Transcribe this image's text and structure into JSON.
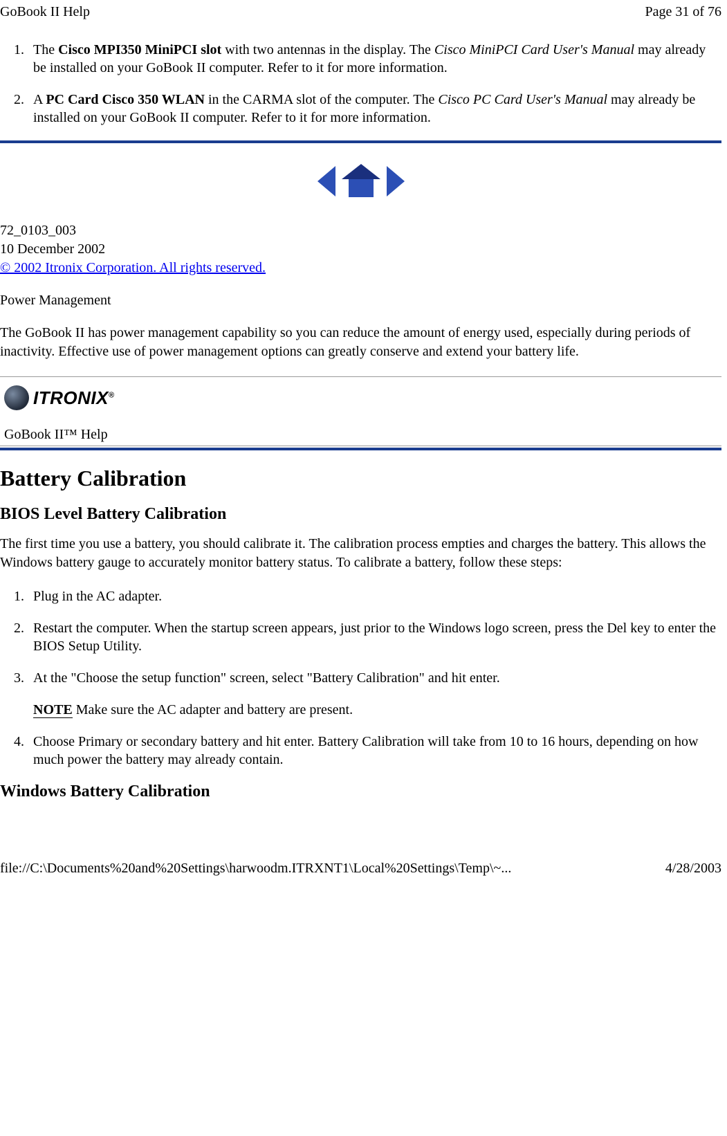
{
  "header": {
    "left": "GoBook II Help",
    "right": "Page 31 of 76"
  },
  "topList": {
    "item1": {
      "preText": "The ",
      "bold1": "Cisco MPI350 MiniPCI slot",
      "midText": " with two antennas in the display.  The ",
      "italic": "Cisco MiniPCI Card User's Manual",
      "tail": " may already be installed on your GoBook II computer.  Refer to it for more information."
    },
    "item2": {
      "preText": "A ",
      "bold1": "PC Card Cisco 350 WLAN",
      "midText": " in the CARMA slot of the computer.  The ",
      "italic": "Cisco PC Card User's Manual",
      "tail": " may already be installed on your GoBook II computer. Refer to it for more information."
    }
  },
  "docInfo": {
    "line1": "72_0103_003",
    "line2": "10 December 2002",
    "copyright": "© 2002 Itronix Corporation.  All rights reserved."
  },
  "powerMgmt": {
    "title": "Power Management",
    "body": "The GoBook II has power management capability so you can reduce the amount of energy used, especially during periods of inactivity.  Effective use of power management options can greatly conserve and extend your battery life."
  },
  "logoBox": {
    "brand": "ITRONIX",
    "reg": "®",
    "help": "GoBook II™ Help"
  },
  "battery": {
    "h1": "Battery Calibration",
    "h2a": "BIOS Level Battery Calibration",
    "intro": "The first time you use a battery, you should calibrate it.  The calibration process empties and charges the battery.  This allows the Windows battery gauge to accurately monitor battery status.  To calibrate a battery, follow these steps:",
    "steps": {
      "s1": "Plug in the AC adapter.",
      "s2": "Restart the computer.  When the startup screen appears, just prior to the Windows logo screen, press the Del key to enter the BIOS Setup Utility.",
      "s3_main": "At the \"Choose the setup function\" screen, select \"Battery Calibration\" and hit enter.",
      "s3_noteLabel": "NOTE",
      "s3_noteText": " Make sure the AC adapter and battery are present.",
      "s4": "Choose Primary or secondary battery and hit enter.  Battery Calibration will take from 10 to 16 hours, depending on how much power the battery may already contain."
    },
    "h2b": "Windows Battery Calibration"
  },
  "footer": {
    "path": "file://C:\\Documents%20and%20Settings\\harwoodm.ITRXNT1\\Local%20Settings\\Temp\\~...",
    "date": "4/28/2003"
  }
}
